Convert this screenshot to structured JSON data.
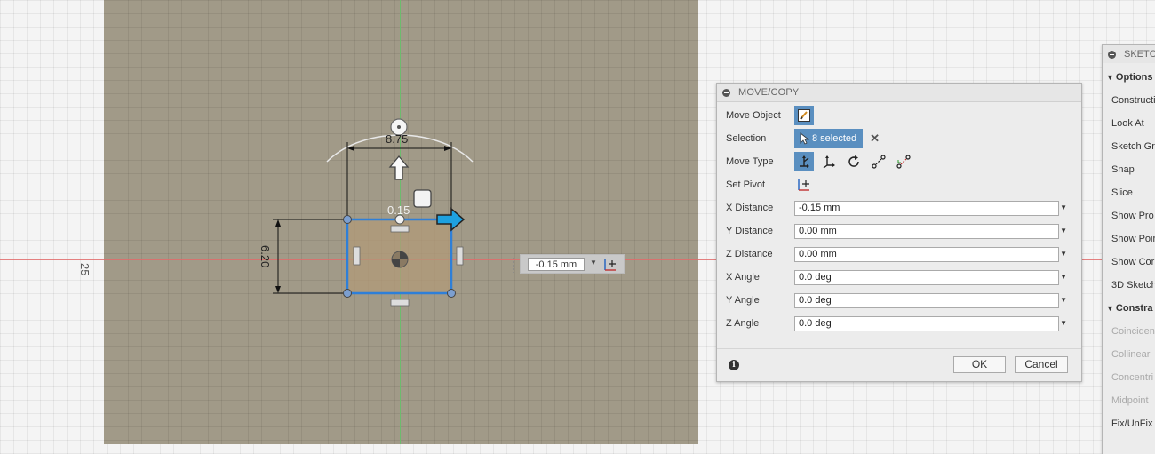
{
  "canvas": {
    "vertical_dim_label": "25",
    "height_dim": "6.20",
    "width_dim": "8.75",
    "offset_dim": "0.15",
    "inline_distance": "-0.15 mm"
  },
  "dialog": {
    "title": "MOVE/COPY",
    "rows": {
      "move_object": "Move Object",
      "selection": "Selection",
      "selection_count": "8 selected",
      "move_type": "Move Type",
      "set_pivot": "Set Pivot",
      "x_distance": {
        "label": "X Distance",
        "value": "-0.15 mm"
      },
      "y_distance": {
        "label": "Y Distance",
        "value": "0.00 mm"
      },
      "z_distance": {
        "label": "Z Distance",
        "value": "0.00 mm"
      },
      "x_angle": {
        "label": "X Angle",
        "value": "0.0 deg"
      },
      "y_angle": {
        "label": "Y Angle",
        "value": "0.0 deg"
      },
      "z_angle": {
        "label": "Z Angle",
        "value": "0.0 deg"
      }
    },
    "ok_label": "OK",
    "cancel_label": "Cancel",
    "accent_color": "#5a8fc0"
  },
  "palette": {
    "title": "SKETC",
    "options_header": "Options",
    "options": [
      "Constructi",
      "Look At",
      "Sketch Gr",
      "Snap",
      "Slice",
      "Show Pro",
      "Show Poir",
      "Show Cor",
      "3D Sketch"
    ],
    "constraints_header": "Constra",
    "constraints": [
      "Coincident",
      "Collinear",
      "Concentri",
      "Midpoint",
      "Fix/UnFix"
    ]
  }
}
